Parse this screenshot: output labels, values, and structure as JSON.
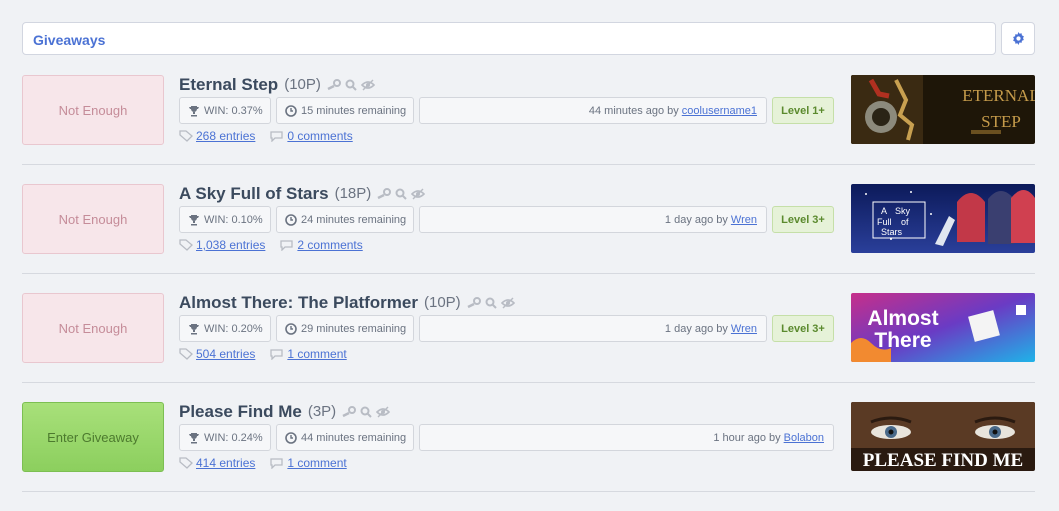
{
  "header": {
    "title": "Giveaways"
  },
  "giveaways": [
    {
      "action": "Not Enough",
      "name": "Eternal Step",
      "points": "(10P)",
      "win": "WIN: 0.37%",
      "remaining": "15 minutes remaining",
      "created_prefix": "44 minutes ago by",
      "creator": "coolusername1",
      "level": "Level 1+",
      "entries": "268 entries",
      "comments": "0 comments",
      "image_text": [
        "ETERNAL",
        "STEP"
      ]
    },
    {
      "action": "Not Enough",
      "name": "A Sky Full of Stars",
      "points": "(18P)",
      "win": "WIN: 0.10%",
      "remaining": "24 minutes remaining",
      "created_prefix": "1 day ago by",
      "creator": "Wren",
      "level": "Level 3+",
      "entries": "1,038 entries",
      "comments": "2 comments",
      "image_text": [
        "A",
        "Sky",
        "Full",
        "of",
        "Stars"
      ]
    },
    {
      "action": "Not Enough",
      "name": "Almost There: The Platformer",
      "points": "(10P)",
      "win": "WIN: 0.20%",
      "remaining": "29 minutes remaining",
      "created_prefix": "1 day ago by",
      "creator": "Wren",
      "level": "Level 3+",
      "entries": "504 entries",
      "comments": "1 comment",
      "image_text": [
        "Almost",
        "There"
      ]
    },
    {
      "action": "Enter Giveaway",
      "name": "Please Find Me",
      "points": "(3P)",
      "win": "WIN: 0.24%",
      "remaining": "44 minutes remaining",
      "created_prefix": "1 hour ago by",
      "creator": "Bolabon",
      "level": "",
      "entries": "414 entries",
      "comments": "1 comment",
      "image_text": [
        "PLEASE FIND ME"
      ]
    }
  ]
}
